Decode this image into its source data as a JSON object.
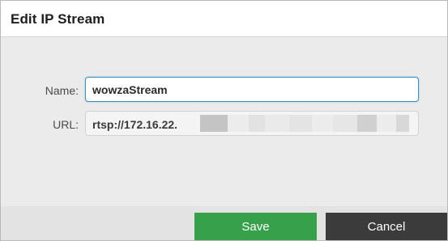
{
  "dialog": {
    "title": "Edit IP Stream"
  },
  "form": {
    "name_label": "Name:",
    "name_value": "wowzaStream",
    "url_label": "URL:",
    "url_value_visible": "rtsp://172.16.22."
  },
  "buttons": {
    "save_label": "Save",
    "cancel_label": "Cancel"
  },
  "colors": {
    "save_button": "#36a04a",
    "cancel_button": "#3b3b3b",
    "focus_border": "#3f8fbf"
  }
}
